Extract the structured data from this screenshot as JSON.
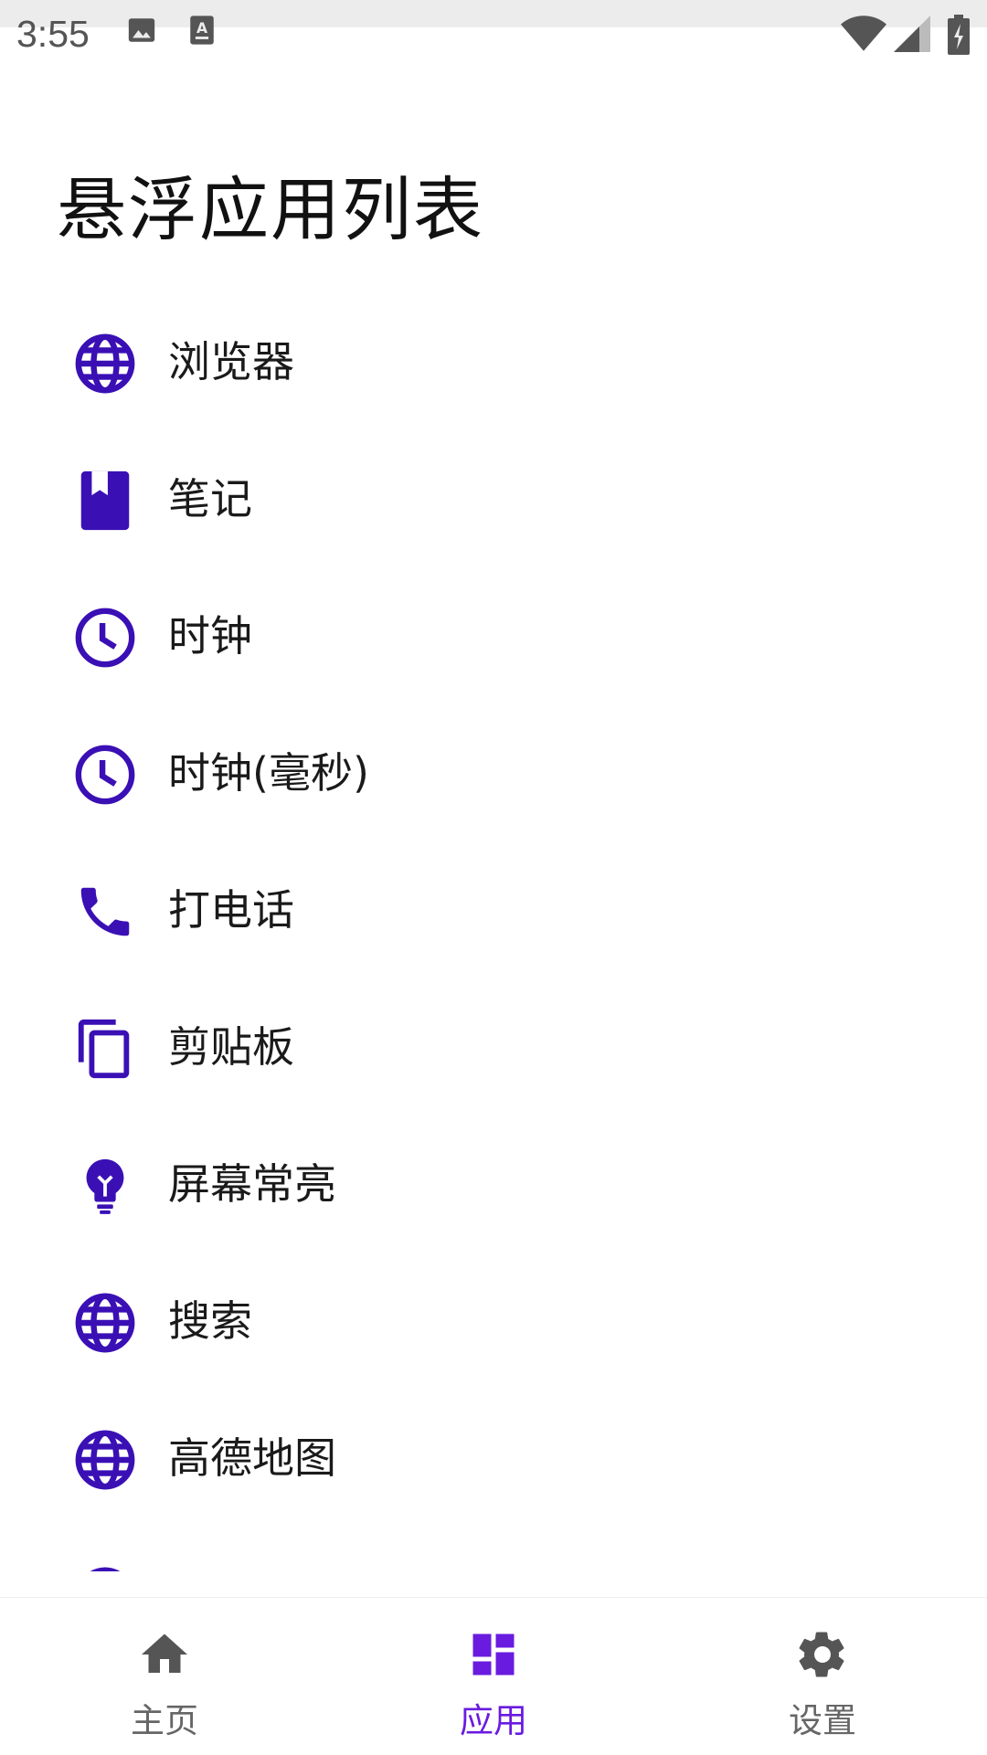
{
  "status_bar": {
    "time": "3:55",
    "icons": [
      "image-icon",
      "keyboard-icon",
      "wifi-icon",
      "signal-icon",
      "battery-charging-icon"
    ]
  },
  "header": {
    "title": "悬浮应用列表"
  },
  "apps": [
    {
      "label": "浏览器",
      "icon": "globe-icon"
    },
    {
      "label": "笔记",
      "icon": "book-icon"
    },
    {
      "label": "时钟",
      "icon": "clock-icon"
    },
    {
      "label": "时钟(毫秒)",
      "icon": "clock-icon"
    },
    {
      "label": "打电话",
      "icon": "phone-icon"
    },
    {
      "label": "剪贴板",
      "icon": "copy-icon"
    },
    {
      "label": "屏幕常亮",
      "icon": "lightbulb-icon"
    },
    {
      "label": "搜索",
      "icon": "globe-icon"
    },
    {
      "label": "高德地图",
      "icon": "globe-icon"
    }
  ],
  "bottom_nav": {
    "items": [
      {
        "label": "主页",
        "icon": "home-icon",
        "active": false
      },
      {
        "label": "应用",
        "icon": "dashboard-icon",
        "active": true
      },
      {
        "label": "设置",
        "icon": "gear-icon",
        "active": false
      }
    ]
  },
  "colors": {
    "accent": "#6a1be0",
    "icon": "#3a10b5",
    "nav_inactive": "#555555"
  }
}
